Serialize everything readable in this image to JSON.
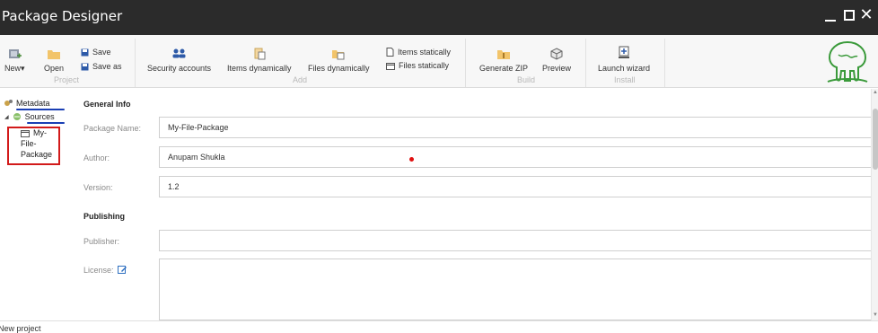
{
  "window": {
    "title": "Package Designer",
    "minimize_glyph": "_",
    "close_glyph": "✕"
  },
  "ribbon": {
    "project": {
      "new_label": "New",
      "new_arrow": "▾",
      "open_label": "Open",
      "save_label": "Save",
      "save_as_label": "Save as",
      "group_label": "Project"
    },
    "add": {
      "security_accounts_label": "Security accounts",
      "items_dynamically_label": "Items dynamically",
      "files_dynamically_label": "Files dynamically",
      "items_statically_label": "Items statically",
      "files_statically_label": "Files statically",
      "group_label": "Add"
    },
    "build": {
      "generate_zip_label": "Generate ZIP",
      "preview_label": "Preview",
      "group_label": "Build"
    },
    "install": {
      "launch_wizard_label": "Launch wizard",
      "group_label": "Install"
    },
    "logo_icon": "tree-logo-icon"
  },
  "tree": {
    "metadata_label": "Metadata",
    "sources_label": "Sources",
    "expand_glyph": "◢",
    "package_label_line1": "My-",
    "package_label_line2": "File-",
    "package_label_line3": "Package"
  },
  "form": {
    "general_info_title": "General Info",
    "package_name_label": "Package Name:",
    "package_name_value": "My-File-Package",
    "author_label": "Author:",
    "author_value": "Anupam Shukla",
    "version_label": "Version:",
    "version_value": "1.2",
    "publishing_title": "Publishing",
    "publisher_label": "Publisher:",
    "publisher_value": "",
    "license_label": "License:"
  },
  "statusbar": {
    "text": "New project"
  },
  "colors": {
    "titlebar": "#2b2b2b",
    "ribbon": "#f7f7f7",
    "highlight_red": "#d21a1a",
    "underline_blue": "#1a3fb4"
  }
}
